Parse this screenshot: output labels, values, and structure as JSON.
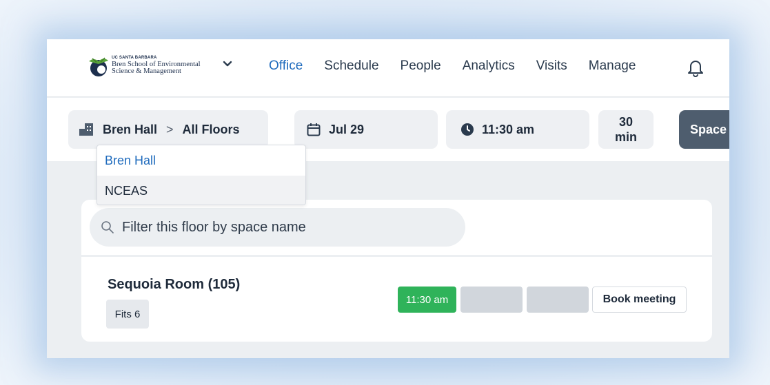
{
  "logo": {
    "line0": "UC SANTA BARBARA",
    "line1": "Bren School of Environmental",
    "line2": "Science & Management"
  },
  "nav": {
    "links": [
      "Office",
      "Schedule",
      "People",
      "Analytics",
      "Visits",
      "Manage"
    ],
    "active": "Office"
  },
  "filters": {
    "building": "Bren Hall",
    "separator": ">",
    "floor": "All Floors",
    "date": "Jul 29",
    "time": "11:30 am",
    "duration_value": "30",
    "duration_unit": "min",
    "space_button": "Space"
  },
  "dropdown": {
    "items": [
      "Bren Hall",
      "NCEAS"
    ],
    "selected": "Bren Hall"
  },
  "search": {
    "placeholder": "Filter this floor by space name"
  },
  "room": {
    "name": "Sequoia Room (105)",
    "capacity": "Fits 6",
    "slot_time": "11:30 am",
    "book_label": "Book meeting"
  },
  "colors": {
    "accent": "#1f6bbd",
    "slot_available": "#2fb35a",
    "space_button": "#4e5d6e"
  }
}
